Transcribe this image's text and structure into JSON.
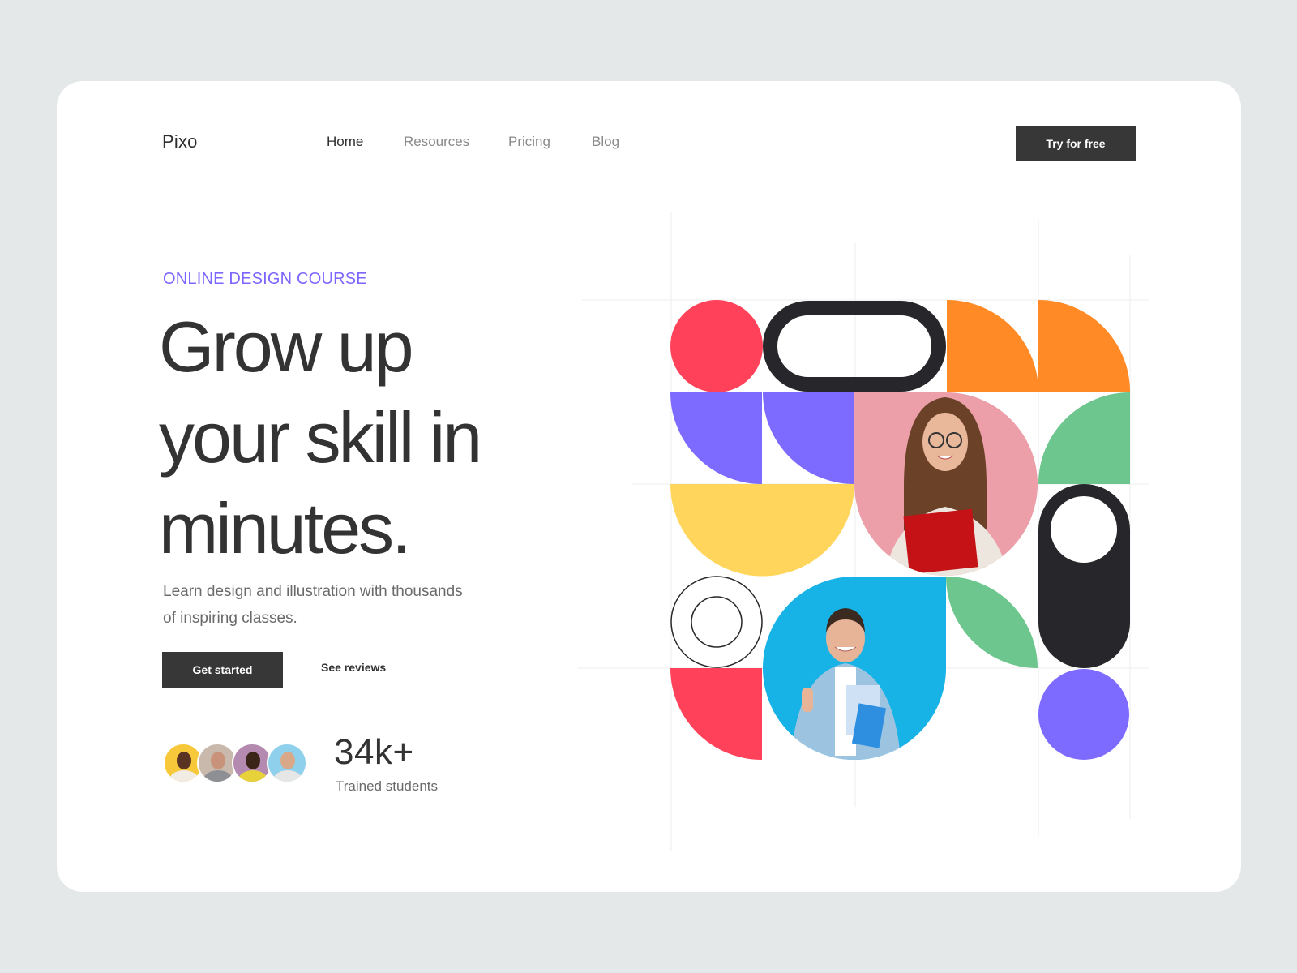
{
  "header": {
    "logo": "Pixo",
    "nav": [
      {
        "label": "Home",
        "active": true
      },
      {
        "label": "Resources",
        "active": false
      },
      {
        "label": "Pricing",
        "active": false
      },
      {
        "label": "Blog",
        "active": false
      }
    ],
    "cta_label": "Try for free"
  },
  "hero": {
    "eyebrow": "ONLINE DESIGN COURSE",
    "headline_lines": [
      "Grow up",
      "your skill in",
      "minutes."
    ],
    "subtitle_lines": [
      "Learn design and illustration with thousands",
      "of inspiring classes."
    ],
    "primary_button": "Get started",
    "secondary_button": "See reviews"
  },
  "stats": {
    "value": "34k+",
    "label": "Trained students",
    "avatars": [
      {
        "bg": "#f7c93a",
        "skin": "#5a3422",
        "shirt": "#f1ece4"
      },
      {
        "bg": "#c9b9ac",
        "skin": "#c8937a",
        "shirt": "#8d8f95"
      },
      {
        "bg": "#b48ab0",
        "skin": "#3b2418",
        "shirt": "#e7d23a"
      },
      {
        "bg": "#8fd0ec",
        "skin": "#d9a888",
        "shirt": "#e6e6e6"
      }
    ]
  },
  "colors": {
    "accent": "#7b66ff",
    "dark": "#373737",
    "red": "#ff4159",
    "orange": "#ff8a26",
    "purple": "#7d6aff",
    "green": "#6dc68d",
    "yellow": "#ffd55c",
    "pink": "#ec9fa8",
    "blue": "#17b2e6",
    "ink": "#27272b"
  }
}
